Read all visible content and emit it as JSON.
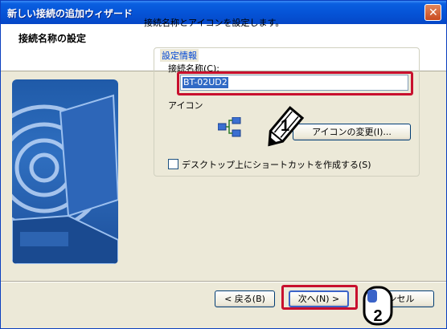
{
  "window": {
    "title": "新しい接続の追加ウィザード"
  },
  "header": {
    "title": "接続名称の設定"
  },
  "content": {
    "intro": "接続名称とアイコンを設定します。",
    "group_title": "設定情報",
    "name_label": "接続名称(C):",
    "name_value": "BT-02UD2",
    "icon_label": "アイコン",
    "change_icon_button": "アイコンの変更(I)...",
    "shortcut_checkbox": {
      "label": "デスクトップ上にショートカットを作成する(S)",
      "checked": false
    }
  },
  "buttons": {
    "back": "< 戻る(B)",
    "next": "次へ(N) >",
    "cancel": "ンセル"
  },
  "annotations": {
    "step1": "1",
    "step2": "2"
  },
  "colors": {
    "title_bar": "#0553d6",
    "highlight": "#c8102e",
    "selection": "#316ac5"
  }
}
